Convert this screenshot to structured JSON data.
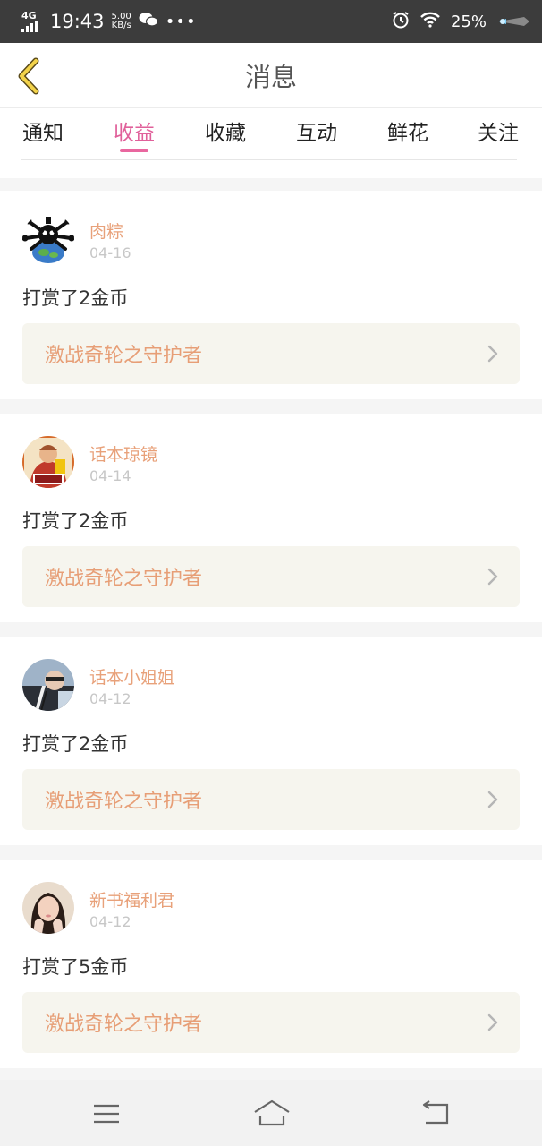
{
  "status_bar": {
    "network": "4G",
    "time": "19:43",
    "speed_value": "5.00",
    "speed_unit": "KB/s",
    "battery": "25%"
  },
  "header": {
    "title": "消息"
  },
  "tabs": [
    {
      "label": "通知",
      "active": false
    },
    {
      "label": "收益",
      "active": true
    },
    {
      "label": "收藏",
      "active": false
    },
    {
      "label": "互动",
      "active": false
    },
    {
      "label": "鲜花",
      "active": false
    },
    {
      "label": "关注",
      "active": false
    }
  ],
  "colors": {
    "accent_pink": "#e9679f",
    "name_orange": "#e8a17a",
    "book_bg": "#f6f5ee"
  },
  "messages": [
    {
      "user": "肉粽",
      "date": "04-16",
      "text": "打赏了2金币",
      "book": "激战奇轮之守护者",
      "avatar_icon": "skull-globe-avatar"
    },
    {
      "user": "话本琼镜",
      "date": "04-14",
      "text": "打赏了2金币",
      "book": "激战奇轮之守护者",
      "avatar_icon": "monk-avatar"
    },
    {
      "user": "话本小姐姐",
      "date": "04-12",
      "text": "打赏了2金币",
      "book": "激战奇轮之守护者",
      "avatar_icon": "photo-avatar"
    },
    {
      "user": "新书福利君",
      "date": "04-12",
      "text": "打赏了5金币",
      "book": "激战奇轮之守护者",
      "avatar_icon": "girl-avatar"
    }
  ],
  "nav": {
    "icons": [
      "menu-icon",
      "home-icon",
      "back-icon"
    ]
  }
}
